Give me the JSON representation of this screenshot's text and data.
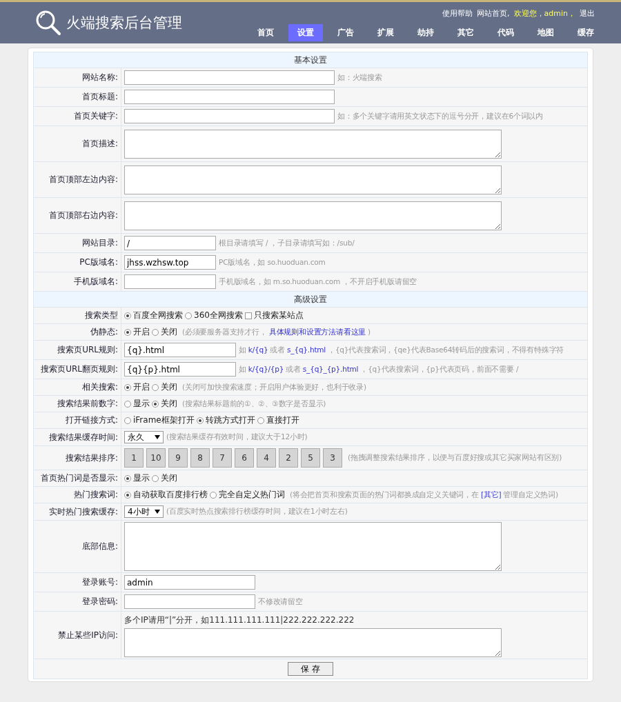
{
  "header": {
    "logo_title": "火端搜索后台管理",
    "user_links": [
      {
        "text": "使用帮助",
        "kind": "link"
      },
      {
        "text": "网站首页,",
        "kind": "link"
      },
      {
        "text": "欢迎您，admin，",
        "kind": "greeting"
      },
      {
        "text": "退出",
        "kind": "link"
      }
    ],
    "nav": [
      {
        "label": "首页",
        "selected": false
      },
      {
        "label": "设置",
        "selected": true
      },
      {
        "label": "广告",
        "selected": false
      },
      {
        "label": "扩展",
        "selected": false
      },
      {
        "label": "劫持",
        "selected": false
      },
      {
        "label": "其它",
        "selected": false
      },
      {
        "label": "代码",
        "selected": false
      },
      {
        "label": "地图",
        "selected": false
      },
      {
        "label": "缓存",
        "selected": false
      }
    ]
  },
  "rows": [
    {
      "kind": "section",
      "label": "基本设置"
    },
    {
      "kind": "long_input",
      "label": "网站名称:",
      "hint": [
        {
          "text": "如：火端搜索",
          "link": false
        }
      ]
    },
    {
      "kind": "long_input",
      "label": "首页标题:"
    },
    {
      "kind": "long_input",
      "label": "首页关键字:",
      "hint": [
        {
          "text": "如：多个关键字请用英文状态下的逗号分开，建议在6个词以内",
          "link": false
        }
      ]
    },
    {
      "kind": "textarea",
      "label": "首页描述:"
    },
    {
      "kind": "textarea",
      "label": "首页顶部左边内容:"
    },
    {
      "kind": "textarea",
      "label": "首页顶部右边内容:"
    },
    {
      "kind": "short_input",
      "label": "网站目录:",
      "value": "/",
      "hint": [
        {
          "text": "根目录请填写 / ，子目录请填写如：/sub/",
          "link": false
        }
      ]
    },
    {
      "kind": "short_input",
      "label": "PC版域名:",
      "value": "jhss.wzhsw.top",
      "hint": [
        {
          "text": "PC版域名，如 so.huoduan.com",
          "link": false
        }
      ]
    },
    {
      "kind": "short_input",
      "label": "手机版域名:",
      "hint": [
        {
          "text": "手机版域名，如 m.so.huoduan.com ，不开启手机版请留空",
          "link": false
        }
      ]
    },
    {
      "kind": "section",
      "label": "高级设置"
    },
    {
      "kind": "choice",
      "label": "搜索类型",
      "options": [
        {
          "kind": "radio",
          "label": "百度全网搜索",
          "selected": true
        },
        {
          "kind": "radio",
          "label": "360全网搜索",
          "selected": false
        },
        {
          "kind": "checkbox",
          "label": "只搜索某站点",
          "selected": false
        }
      ]
    },
    {
      "kind": "choice",
      "label": "伪静态:",
      "options": [
        {
          "kind": "radio",
          "label": "开启",
          "selected": true
        },
        {
          "kind": "radio",
          "label": "关闭",
          "selected": false
        }
      ],
      "hint": [
        {
          "text": "(必须要服务器支持才行，",
          "link": false
        },
        {
          "text": "具体规则和设置方法请看这里",
          "link": true
        },
        {
          "text": ")",
          "link": false
        }
      ]
    },
    {
      "kind": "medium_input",
      "label": "搜索页URL规则:",
      "value": "{q}.html",
      "hint": [
        {
          "text": "如",
          "link": false
        },
        {
          "text": "k/{q}",
          "link": true
        },
        {
          "text": "或者",
          "link": false
        },
        {
          "text": "s_{q}.html",
          "link": true
        },
        {
          "text": "，{q}代表搜索词，{qe}代表Base64转码后的搜索词，不得有特殊字符",
          "link": false
        }
      ]
    },
    {
      "kind": "medium_input",
      "label": "搜索页URL翻页规则:",
      "value": "{q}{p}.html",
      "hint": [
        {
          "text": "如",
          "link": false
        },
        {
          "text": "k/{q}/{p}",
          "link": true
        },
        {
          "text": "或者",
          "link": false
        },
        {
          "text": "s_{q}_{p}.html",
          "link": true
        },
        {
          "text": "，{q}代表搜索词，{p}代表页码，前面不需要 /",
          "link": false
        }
      ]
    },
    {
      "kind": "choice",
      "label": "相关搜索:",
      "options": [
        {
          "kind": "radio",
          "label": "开启",
          "selected": true
        },
        {
          "kind": "radio",
          "label": "关闭",
          "selected": false
        }
      ],
      "hint": [
        {
          "text": "(关闭可加快搜索速度；开启用户体验更好，也利于收录)",
          "link": false
        }
      ]
    },
    {
      "kind": "choice",
      "label": "搜索结果前数字:",
      "options": [
        {
          "kind": "radio",
          "label": "显示",
          "selected": false
        },
        {
          "kind": "radio",
          "label": "关闭",
          "selected": true
        }
      ],
      "hint": [
        {
          "text": "(搜索结果标题前的①、②、③数字是否显示)",
          "link": false
        }
      ]
    },
    {
      "kind": "choice",
      "label": "打开链接方式:",
      "options": [
        {
          "kind": "radio",
          "label": "iFrame框架打开",
          "selected": false
        },
        {
          "kind": "radio",
          "label": "转跳方式打开",
          "selected": true
        },
        {
          "kind": "radio",
          "label": "直接打开",
          "selected": false
        }
      ]
    },
    {
      "kind": "select",
      "label": "搜索结果缓存时间:",
      "value": "永久",
      "hint": [
        {
          "text": "(搜索结果缓存有效时间，建议大于12小时)",
          "link": false
        }
      ]
    },
    {
      "kind": "sort",
      "label": "搜索结果排序:",
      "items": [
        "1",
        "10",
        "9",
        "8",
        "7",
        "6",
        "4",
        "2",
        "5",
        "3"
      ],
      "hint": [
        {
          "text": "(拖拽调整搜索结果排序，以便与百度好搜或其它买家网站有区别)",
          "link": false
        }
      ]
    },
    {
      "kind": "choice",
      "label": "首页热门词是否显示:",
      "options": [
        {
          "kind": "radio",
          "label": "显示",
          "selected": true
        },
        {
          "kind": "radio",
          "label": "关闭",
          "selected": false
        }
      ]
    },
    {
      "kind": "choice",
      "label": "热门搜索词:",
      "options": [
        {
          "kind": "radio",
          "label": "自动获取百度排行榜",
          "selected": true
        },
        {
          "kind": "radio",
          "label": "完全自定义热门词",
          "selected": false
        }
      ],
      "hint": [
        {
          "text": "(将会把首页和搜索页面的热门词都换成自定义关键词，在",
          "link": false
        },
        {
          "text": "[其它]",
          "link": true
        },
        {
          "text": "管理自定义热词)",
          "link": false
        }
      ]
    },
    {
      "kind": "select",
      "label": "实时热门搜索缓存:",
      "value": "4小时",
      "hint": [
        {
          "text": "(百度实时热点搜索排行榜缓存时间，建议在1小时左右)",
          "link": false
        }
      ]
    },
    {
      "kind": "textarea",
      "label": "底部信息:",
      "tall": true
    },
    {
      "kind": "login_input",
      "label": "登录账号:",
      "value": "admin"
    },
    {
      "kind": "login_input",
      "label": "登录密码:",
      "hint": [
        {
          "text": "不修改请留空",
          "link": false
        }
      ]
    },
    {
      "kind": "textarea",
      "label": "禁止某些IP访问:",
      "note": "多个IP请用“|”分开，如111.111.111.111|222.222.222.222"
    }
  ],
  "save_button": "保 存"
}
